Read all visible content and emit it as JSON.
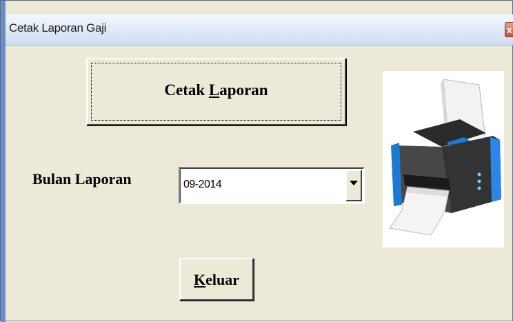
{
  "window": {
    "title": "Cetak Laporan Gaji",
    "close_glyph": "x"
  },
  "buttons": {
    "cetak_prefix": "Cetak ",
    "cetak_mnemonic": "L",
    "cetak_suffix": "aporan",
    "keluar_mnemonic": "K",
    "keluar_suffix": "eluar"
  },
  "form": {
    "bulan_label": "Bulan Laporan",
    "bulan_value": "09-2014"
  },
  "icons": {
    "printer": "printer-icon",
    "dropdown": "chevron-down-icon",
    "close": "close-icon"
  },
  "colors": {
    "window_bg": "#ece9d8",
    "title_gradient_top": "#f4f8fe",
    "printer_blue": "#1e78d6"
  }
}
